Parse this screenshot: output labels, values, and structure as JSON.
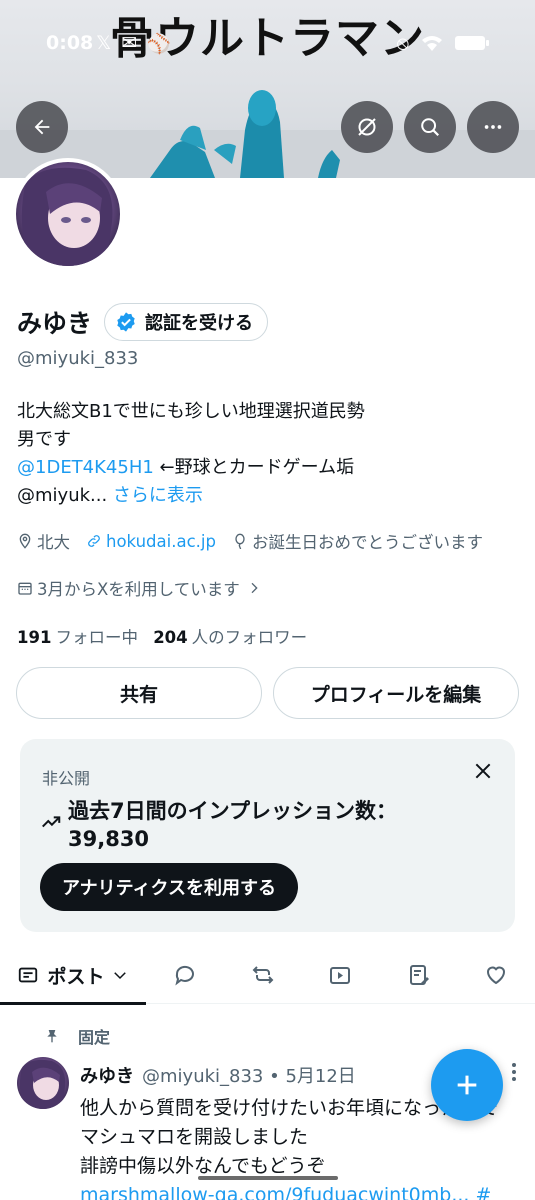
{
  "overlay_title": "骨ウルトラマン",
  "status_bar": {
    "time": "0:08"
  },
  "profile": {
    "display_name": "みゆき",
    "verify_label": "認証を受ける",
    "handle": "@miyuki_833",
    "bio_line1": "北大総文B1で世にも珍しい地理選択道民勢",
    "bio_line2": "男です",
    "bio_mention": "@1DET4K45H1",
    "bio_line3_rest": " ←野球とカードゲーム垢",
    "bio_line4_prefix": "@miyuk... ",
    "show_more": "さらに表示",
    "location": "北大",
    "website": "hokudai.ac.jp",
    "birthday": "お誕生日おめでとうございます",
    "joined": "3月からXを利用しています",
    "following_count": "191",
    "following_label": "フォロー中",
    "followers_count": "204",
    "followers_label": "人のフォロワー"
  },
  "actions": {
    "share": "共有",
    "edit_profile": "プロフィールを編集"
  },
  "analytics_card": {
    "label": "非公開",
    "impressions_line": "過去7日間のインプレッション数：",
    "impressions_value": "39,830",
    "cta": "アナリティクスを利用する"
  },
  "tabs": {
    "posts": "ポスト"
  },
  "pinned_post": {
    "pinned_label": "固定",
    "author": "みゆき",
    "meta": "@miyuki_833 • 5月12日",
    "line1": "他人から質問を受け付けたいお年頃にな",
    "line1_tail": "ったので",
    "line2": "マシュマロを開設しました",
    "line3": "誹謗中傷以外なんでもどうぞ",
    "link": "marshmallow-qa.com/9fuduacwint0mb... #"
  },
  "colors": {
    "accent": "#1d9bf0",
    "text": "#0f1419",
    "muted": "#536471",
    "card_bg": "#eff3f4"
  }
}
